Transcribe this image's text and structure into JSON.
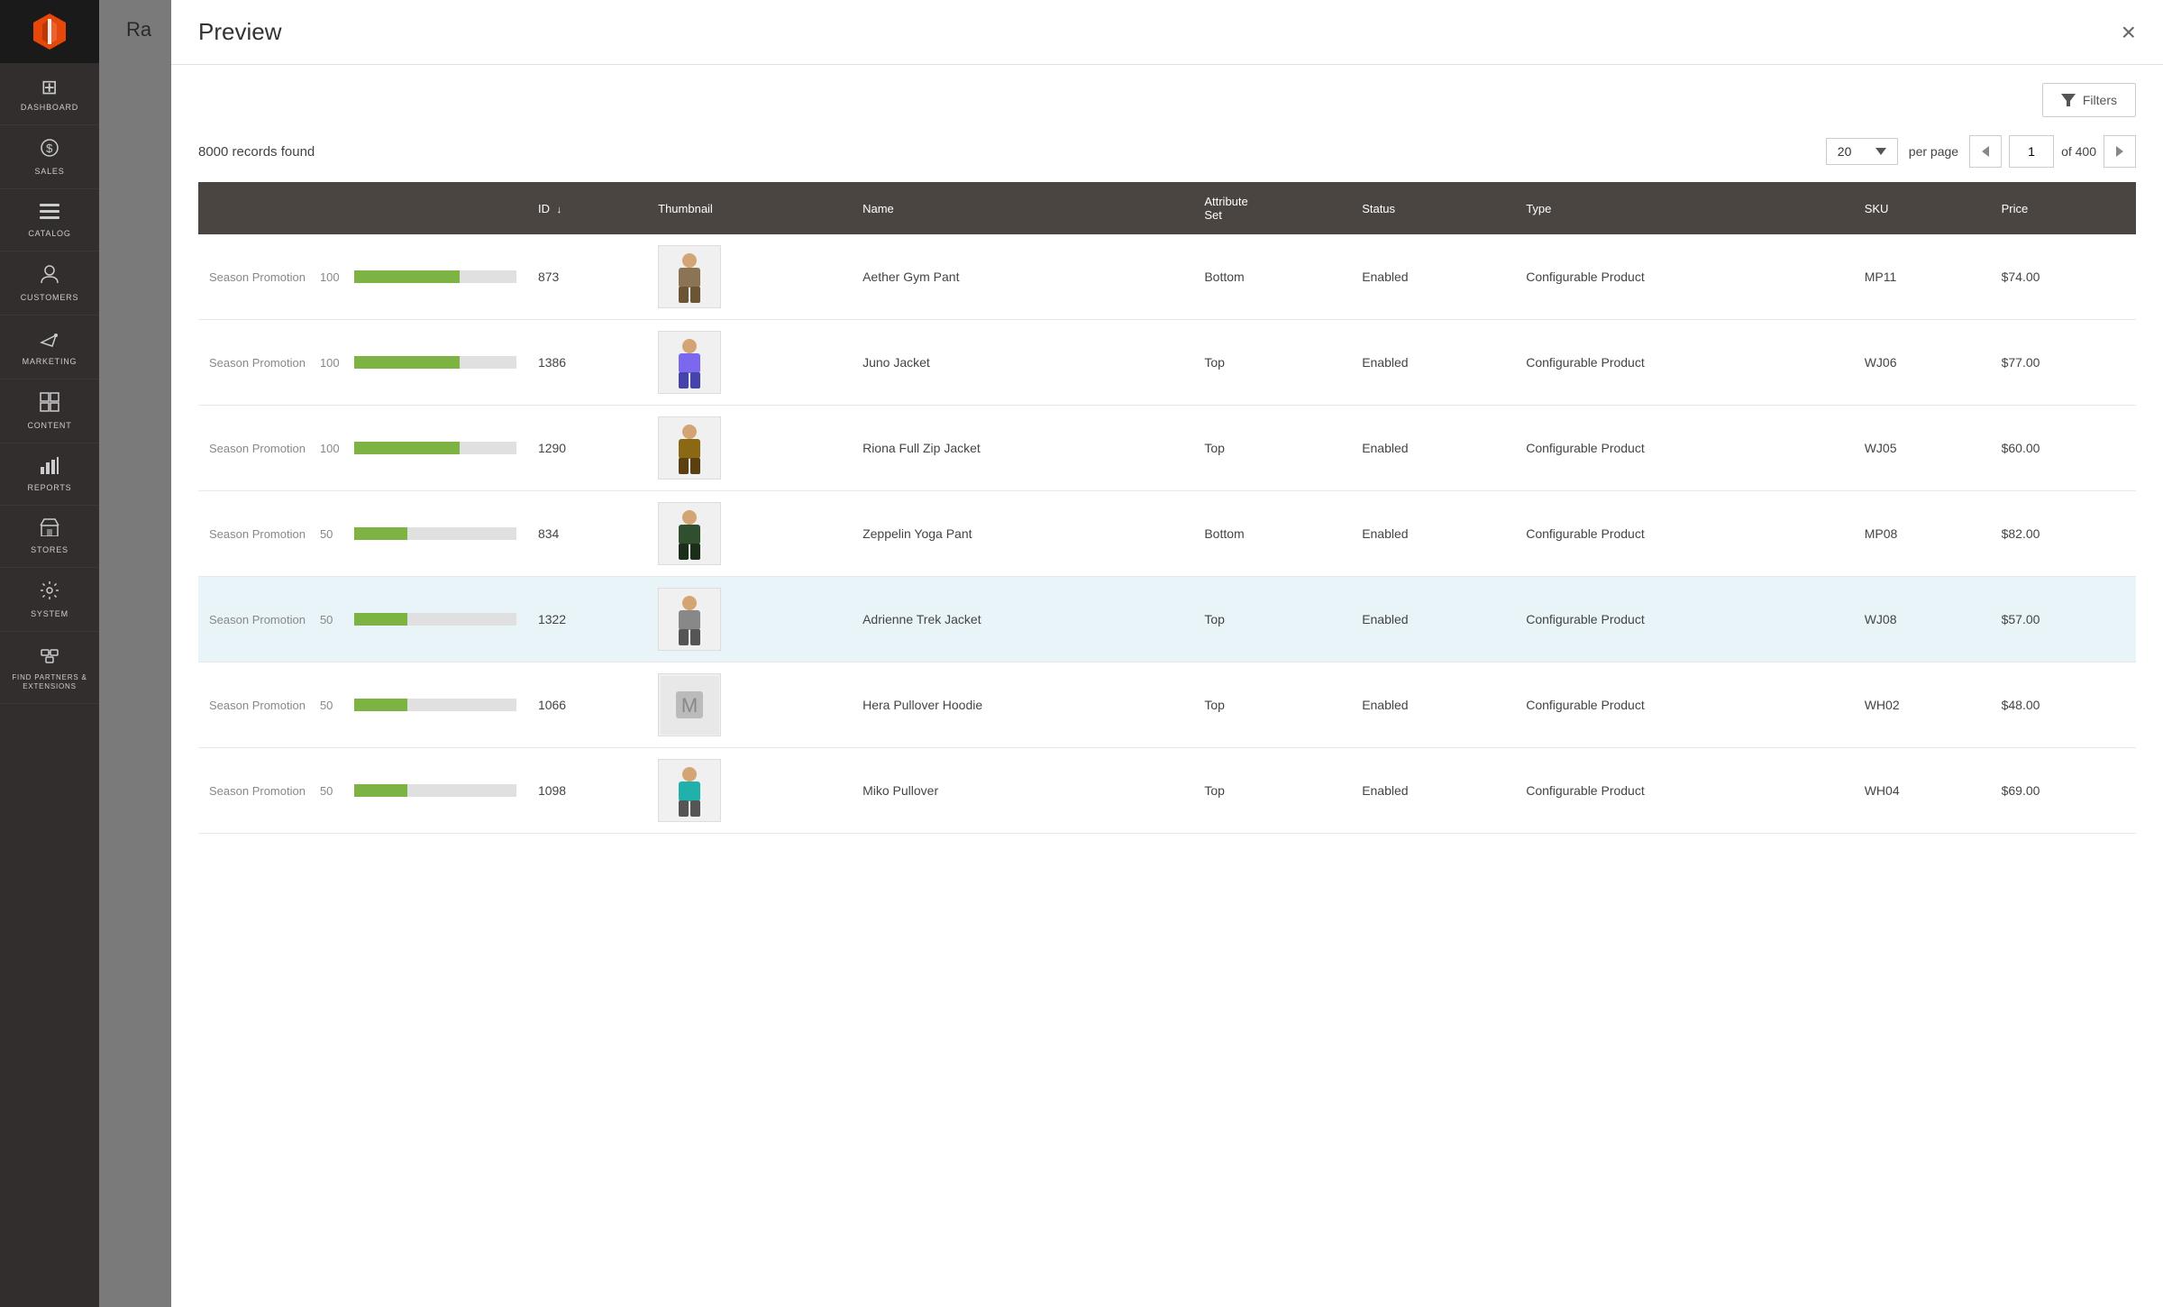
{
  "sidebar": {
    "logo": "Magento",
    "items": [
      {
        "id": "dashboard",
        "label": "DASHBOARD",
        "icon": "⊞"
      },
      {
        "id": "sales",
        "label": "SALES",
        "icon": "$"
      },
      {
        "id": "catalog",
        "label": "CATALOG",
        "icon": "☰"
      },
      {
        "id": "customers",
        "label": "CUSTOMERS",
        "icon": "👤"
      },
      {
        "id": "marketing",
        "label": "MARKETING",
        "icon": "📣"
      },
      {
        "id": "content",
        "label": "CONTENT",
        "icon": "▦"
      },
      {
        "id": "reports",
        "label": "REPORTS",
        "icon": "📊"
      },
      {
        "id": "stores",
        "label": "STORES",
        "icon": "🏪"
      },
      {
        "id": "system",
        "label": "SYSTEM",
        "icon": "⚙"
      },
      {
        "id": "partners",
        "label": "FIND PARTNERS & EXTENSIONS",
        "icon": "🧩"
      }
    ]
  },
  "modal": {
    "title": "Preview",
    "close_label": "×",
    "filters_button": "Filters",
    "records_count": "8000 records found",
    "per_page_value": "20",
    "per_page_label": "per page",
    "page_current": "1",
    "page_total": "of 400",
    "columns": [
      {
        "id": "name_col",
        "label": ""
      },
      {
        "id": "id_col",
        "label": "ID",
        "sortable": true,
        "sort_dir": "desc"
      },
      {
        "id": "thumbnail_col",
        "label": "Thumbnail"
      },
      {
        "id": "name_col2",
        "label": "Name"
      },
      {
        "id": "attribute_set_col",
        "label": "Attribute Set"
      },
      {
        "id": "status_col",
        "label": "Status"
      },
      {
        "id": "type_col",
        "label": "Type"
      },
      {
        "id": "sku_col",
        "label": "SKU"
      },
      {
        "id": "price_col",
        "label": "Price"
      }
    ],
    "rows": [
      {
        "rule": "Season Promotion",
        "score": 100,
        "progress": 65,
        "id": "873",
        "thumbnail": "pants",
        "name": "Aether Gym Pant",
        "attribute_set": "Bottom",
        "status": "Enabled",
        "type": "Configurable Product",
        "sku": "MP11",
        "price": "$74.00",
        "highlighted": false
      },
      {
        "rule": "Season Promotion",
        "score": 100,
        "progress": 65,
        "id": "1386",
        "thumbnail": "jacket-purple",
        "name": "Juno Jacket",
        "attribute_set": "Top",
        "status": "Enabled",
        "type": "Configurable Product",
        "sku": "WJ06",
        "price": "$77.00",
        "highlighted": false
      },
      {
        "rule": "Season Promotion",
        "score": 100,
        "progress": 65,
        "id": "1290",
        "thumbnail": "jacket-brown",
        "name": "Riona Full Zip Jacket",
        "attribute_set": "Top",
        "status": "Enabled",
        "type": "Configurable Product",
        "sku": "WJ05",
        "price": "$60.00",
        "highlighted": false
      },
      {
        "rule": "Season Promotion",
        "score": 50,
        "progress": 33,
        "id": "834",
        "thumbnail": "pants-dark",
        "name": "Zeppelin Yoga Pant",
        "attribute_set": "Bottom",
        "status": "Enabled",
        "type": "Configurable Product",
        "sku": "MP08",
        "price": "$82.00",
        "highlighted": false
      },
      {
        "rule": "Season Promotion",
        "score": 50,
        "progress": 33,
        "id": "1322",
        "thumbnail": "jacket-grey",
        "name": "Adrienne Trek Jacket",
        "attribute_set": "Top",
        "status": "Enabled",
        "type": "Configurable Product",
        "sku": "WJ08",
        "price": "$57.00",
        "highlighted": true
      },
      {
        "rule": "Season Promotion",
        "score": 50,
        "progress": 33,
        "id": "1066",
        "thumbnail": "placeholder",
        "name": "Hera Pullover Hoodie",
        "attribute_set": "Top",
        "status": "Enabled",
        "type": "Configurable Product",
        "sku": "WH02",
        "price": "$48.00",
        "highlighted": false
      },
      {
        "rule": "Season Promotion",
        "score": 50,
        "progress": 33,
        "id": "1098",
        "thumbnail": "jacket-teal",
        "name": "Miko Pullover",
        "attribute_set": "Top",
        "status": "Enabled",
        "type": "Configurable Product",
        "sku": "WH04",
        "price": "$69.00",
        "highlighted": false
      }
    ]
  },
  "colors": {
    "sidebar_bg": "#332e2e",
    "table_header_bg": "#4a4541",
    "progress_fill": "#7cb342",
    "progress_empty": "#e0e0e0",
    "highlight_row": "#e8f4f8",
    "accent_orange": "#e8470a"
  }
}
